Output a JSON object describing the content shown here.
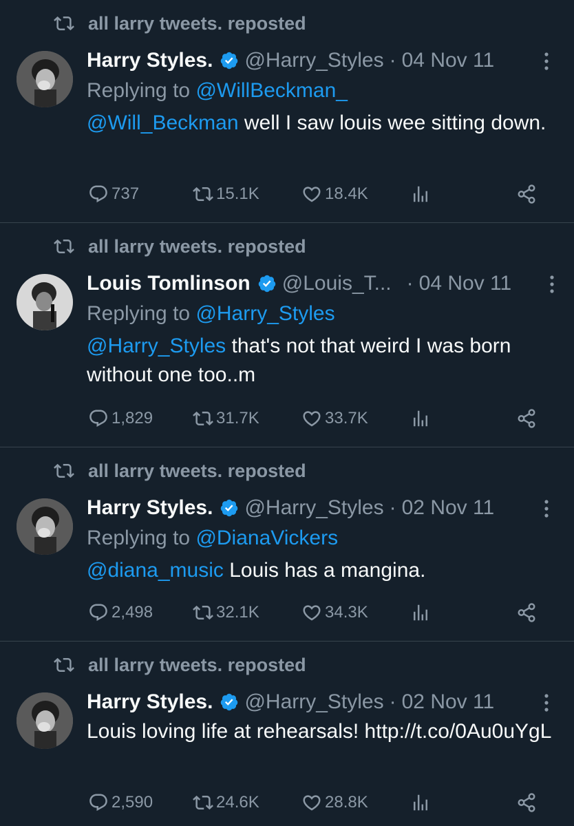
{
  "colors": {
    "background": "#15202b",
    "text_primary": "#f7f9f9",
    "text_secondary": "#8b98a5",
    "mention": "#1d9bf0",
    "verified": "#1d9bf0",
    "divider": "#38444d"
  },
  "tweets": [
    {
      "repost_label": "all larry tweets. reposted",
      "author_name": "Harry Styles.",
      "handle": "@Harry_Styles",
      "separator": "·",
      "date": "04 Nov 11",
      "replying_prefix": "Replying to ",
      "replying_to": "@WillBeckman_",
      "body_mention": "@Will_Beckman",
      "body_text": " well I saw louis wee sitting down.",
      "replies": "737",
      "reposts": "15.1K",
      "likes": "18.4K",
      "avatar_icon": "avatar-harry"
    },
    {
      "repost_label": "all larry tweets. reposted",
      "author_name": "Louis Tomlinson",
      "handle": "@Louis_T...",
      "separator": "·",
      "date": "04 Nov 11",
      "replying_prefix": "Replying to ",
      "replying_to": "@Harry_Styles",
      "body_mention": "@Harry_Styles",
      "body_text": " that's not that weird I was born without one too..m",
      "replies": "1,829",
      "reposts": "31.7K",
      "likes": "33.7K",
      "avatar_icon": "avatar-louis"
    },
    {
      "repost_label": "all larry tweets. reposted",
      "author_name": "Harry Styles.",
      "handle": "@Harry_Styles",
      "separator": "·",
      "date": "02 Nov 11",
      "replying_prefix": "Replying to ",
      "replying_to": "@DianaVickers",
      "body_mention": "@diana_music",
      "body_text": " Louis has a mangina.",
      "replies": "2,498",
      "reposts": "32.1K",
      "likes": "34.3K",
      "avatar_icon": "avatar-harry"
    },
    {
      "repost_label": "all larry tweets. reposted",
      "author_name": "Harry Styles.",
      "handle": "@Harry_Styles",
      "separator": "·",
      "date": "02 Nov 11",
      "body_text": "Louis loving life at rehearsals! http://t.co/0Au0uYgL",
      "replies": "2,590",
      "reposts": "24.6K",
      "likes": "28.8K",
      "avatar_icon": "avatar-harry"
    }
  ]
}
